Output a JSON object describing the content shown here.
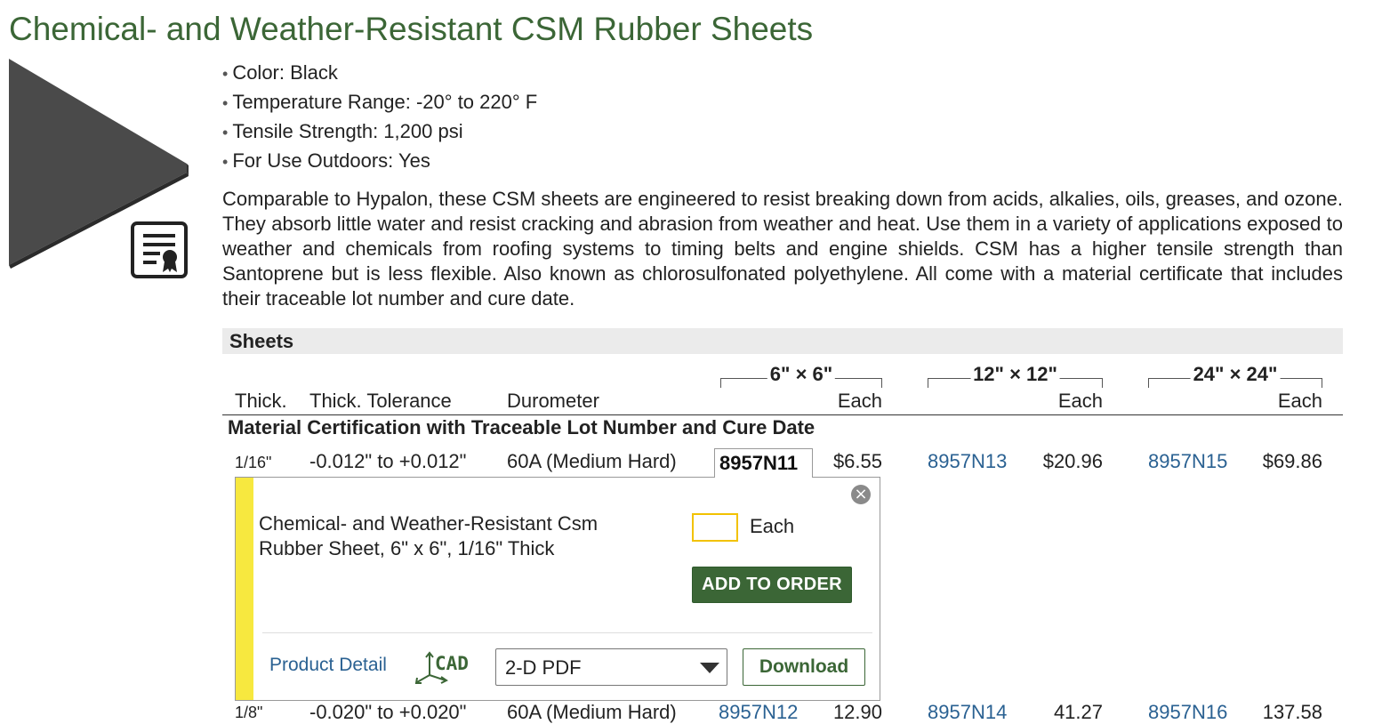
{
  "page_title": "Chemical- and Weather-Resistant CSM Rubber Sheets",
  "specs": [
    "Color: Black",
    "Temperature Range: -20° to 220° F",
    "Tensile Strength: 1,200 psi",
    "For Use Outdoors: Yes"
  ],
  "description": "Comparable to Hypalon, these CSM sheets are engineered to resist breaking down from acids, alkalies, oils, greases, and ozone. They absorb little water and resist cracking and abrasion from weather and heat. Use them in a variety of applications exposed to weather and chemicals from roofing systems to timing belts and engine shields. CSM has a higher tensile strength than Santoprene but is less flexible. Also known as chlorosulfonated polyethylene. All come with a material certificate that includes their traceable lot number and cure date.",
  "table": {
    "section_title": "Sheets",
    "size_groups": [
      "6\" × 6\"",
      "12\" × 12\"",
      "24\" × 24\""
    ],
    "columns": {
      "thick": "Thick.",
      "tolerance": "Thick. Tolerance",
      "durometer": "Durometer",
      "each": "Each"
    },
    "group_title": "Material Certification with Traceable Lot Number and Cure Date",
    "rows": [
      {
        "thick": "1/16\"",
        "tolerance": "-0.012\" to +0.012\"",
        "durometer": "60A (Medium Hard)",
        "part1": "8957N11",
        "price1": "$6.55",
        "part2": "8957N13",
        "price2": "$20.96",
        "part3": "8957N15",
        "price3": "$69.86"
      },
      {
        "thick": "1/8\"",
        "tolerance": "-0.020\" to +0.020\"",
        "durometer": "60A (Medium Hard)",
        "part1": "8957N12",
        "price1": "12.90",
        "part2": "8957N14",
        "price2": "41.27",
        "part3": "8957N16",
        "price3": "137.58"
      }
    ]
  },
  "popup": {
    "description": "Chemical- and Weather-Resistant Csm Rubber Sheet, 6\" x 6\", 1/16\" Thick",
    "quantity_value": "",
    "each_label": "Each",
    "add_button": "ADD TO ORDER",
    "close_icon": "×",
    "product_detail_link": "Product Detail",
    "cad_label": "CAD",
    "format_selected": "2-D PDF",
    "download_button": "Download"
  },
  "colors": {
    "title_green": "#3b6636",
    "link_blue": "#2a6192",
    "highlight_yellow": "#f7e83f",
    "section_gray": "#ebebeb"
  }
}
